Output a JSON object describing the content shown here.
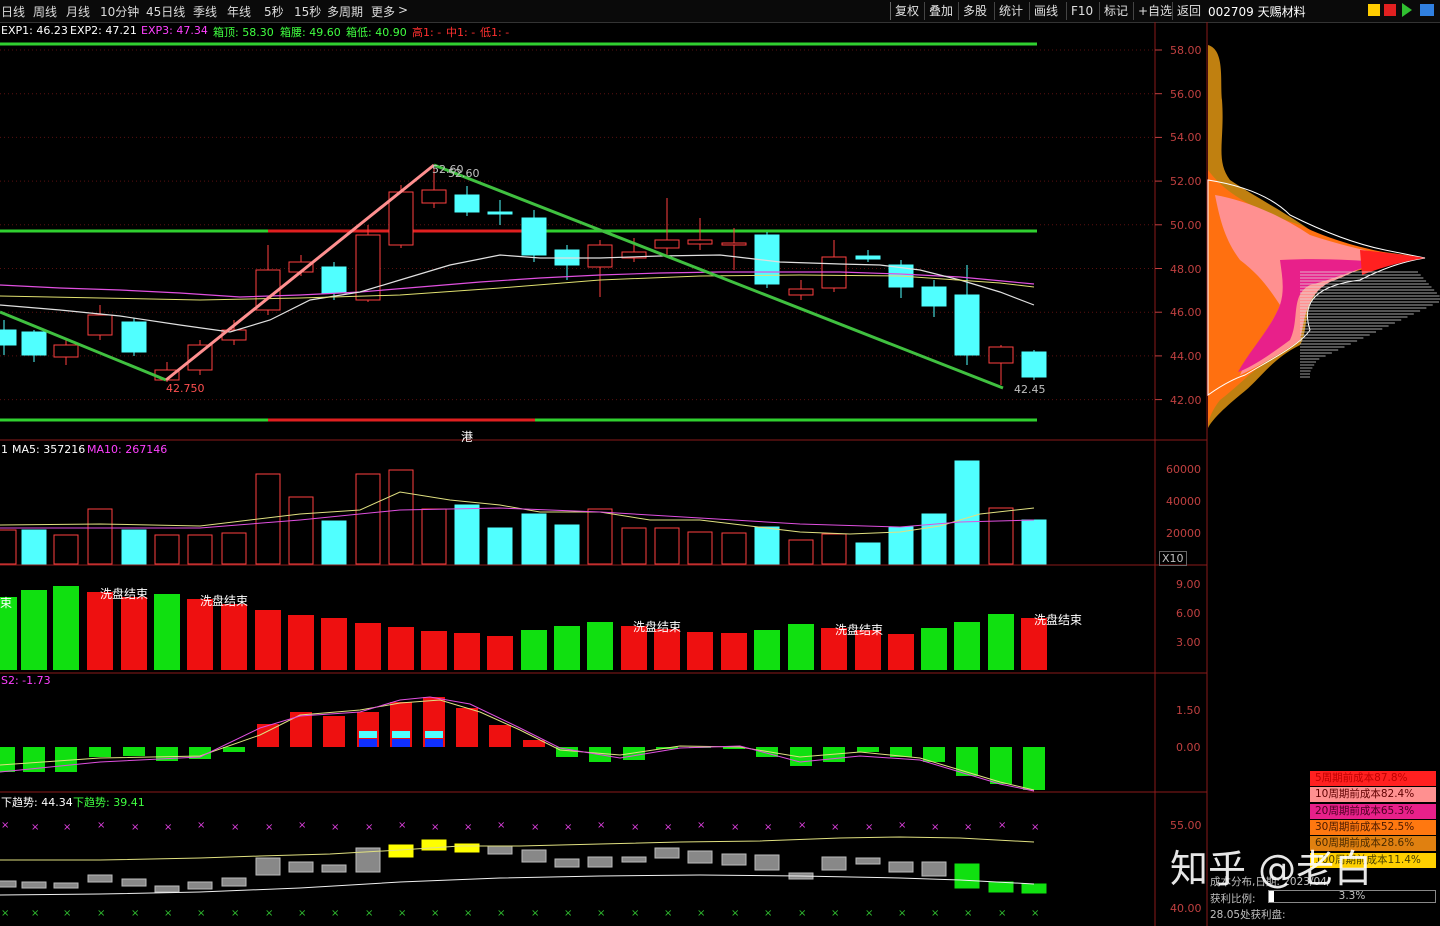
{
  "toolbar": {
    "periods": [
      "日线",
      "周线",
      "月线",
      "10分钟",
      "45日线",
      "季线",
      "年线",
      "5秒",
      "15秒",
      "多周期",
      "更多"
    ],
    "more_arrow": ">",
    "buttons": [
      "复权",
      "叠加",
      "多股",
      "统计",
      "画线",
      "F10",
      "标记",
      "+自选",
      "返回"
    ],
    "stock_title": "002709 天赐材料"
  },
  "main_info": {
    "exp1": "EXP1: 46.23",
    "exp2": "EXP2: 47.21",
    "exp3": "EXP3: 47.34",
    "box_top": "箱顶: 58.30",
    "box_mid": "箱腰: 49.60",
    "box_low": "箱低: 40.90",
    "high": "高1: -",
    "mid": "中1: -",
    "low": "低1: -"
  },
  "price_axis": [
    "58.00",
    "56.00",
    "54.00",
    "52.00",
    "50.00",
    "48.00",
    "46.00",
    "44.00",
    "42.00"
  ],
  "annotations": {
    "high_mark": "52.60",
    "high_mark2": "52.60",
    "low_mark": "42.750",
    "low_mark2": "42.45",
    "hk_tag": "港"
  },
  "volume_info": {
    "prefix": "1",
    "ma5": "MA5: 357216",
    "ma10": "MA10: 267146",
    "axis": [
      "60000",
      "40000",
      "20000"
    ],
    "unit": "X10"
  },
  "ind1": {
    "labels": [
      "洗盘结束",
      "洗盘结束",
      "洗盘结束",
      "洗盘结束",
      "洗盘结束"
    ],
    "left_cut": "束",
    "axis": [
      "9.00",
      "6.00",
      "3.00"
    ]
  },
  "ind2": {
    "label": "S2: -1.73",
    "axis": [
      "1.50",
      "0.00"
    ]
  },
  "ind3": {
    "label1": "下趋势: 44.34",
    "label2": "下趋势: 39.41",
    "axis": [
      "55.00",
      "40.00"
    ]
  },
  "cost": {
    "rows": [
      {
        "label": "5周期前成本87.8%",
        "bg": "#ff2020",
        "fg": "#c00000"
      },
      {
        "label": "10周期前成本82.4%",
        "bg": "#ff9090",
        "fg": "#600000"
      },
      {
        "label": "20周期前成本65.3%",
        "bg": "#e8208a",
        "fg": "#4a0020"
      },
      {
        "label": "30周期前成本52.5%",
        "bg": "#ff7810",
        "fg": "#4a1a00"
      },
      {
        "label": "60周期前成本28.6%",
        "bg": "#e08010",
        "fg": "#4a2a00"
      },
      {
        "label": "100周期前成本11.4%",
        "bg": "#ffd000",
        "fg": "#4a4000"
      }
    ],
    "dist_date": "成本分布,日期: 2023/04/",
    "profit_label": "获利比例:",
    "profit_value": "3.3%",
    "profit_at": "28.05处获利盘:"
  },
  "watermark": "知乎 @老白"
}
